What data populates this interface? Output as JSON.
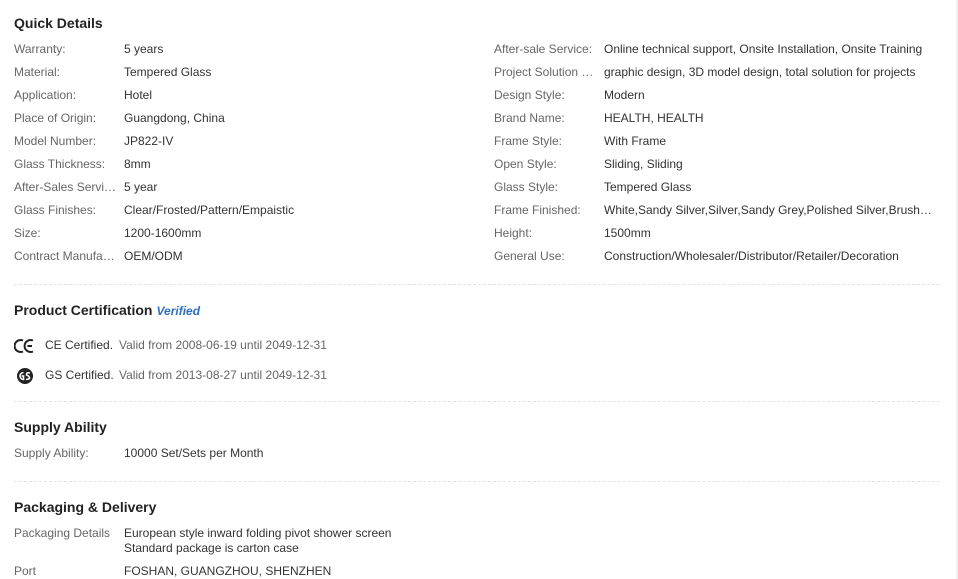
{
  "quick_details": {
    "title": "Quick Details",
    "left": [
      {
        "label": "Warranty:",
        "value": "5 years"
      },
      {
        "label": "Material:",
        "value": "Tempered Glass"
      },
      {
        "label": "Application:",
        "value": "Hotel"
      },
      {
        "label": "Place of Origin:",
        "value": "Guangdong, China"
      },
      {
        "label": "Model Number:",
        "value": "JP822-IV"
      },
      {
        "label": "Glass Thickness:",
        "value": "8mm"
      },
      {
        "label": "After-Sales Service:",
        "value": "5 year"
      },
      {
        "label": "Glass Finishes:",
        "value": "Clear/Frosted/Pattern/Empaistic"
      },
      {
        "label": "Size:",
        "value": "1200-1600mm"
      },
      {
        "label": "Contract Manufact...",
        "value": "OEM/ODM"
      }
    ],
    "right": [
      {
        "label": "After-sale Service:",
        "value": "Online technical support, Onsite Installation, Onsite Training"
      },
      {
        "label": "Project Solution Ca...",
        "value": "graphic design, 3D model design, total solution for projects"
      },
      {
        "label": "Design Style:",
        "value": "Modern"
      },
      {
        "label": "Brand Name:",
        "value": "HEALTH, HEALTH"
      },
      {
        "label": "Frame Style:",
        "value": "With Frame"
      },
      {
        "label": "Open Style:",
        "value": "Sliding, Sliding"
      },
      {
        "label": "Glass Style:",
        "value": "Tempered Glass"
      },
      {
        "label": "Frame Finished:",
        "value": "White,Sandy Silver,Silver,Sandy Grey,Polished Silver,Brushed Si..."
      },
      {
        "label": "Height:",
        "value": "1500mm"
      },
      {
        "label": "General Use:",
        "value": "Construction/Wholesaler/Distributor/Retailer/Decoration"
      }
    ]
  },
  "product_certification": {
    "title": "Product Certification",
    "verified": "Verified",
    "items": [
      {
        "icon": "ce-mark-icon",
        "name": "CE Certified.",
        "valid": "Valid from 2008-06-19 until 2049-12-31"
      },
      {
        "icon": "gs-mark-icon",
        "name": "GS Certified.",
        "valid": "Valid from 2013-08-27 until 2049-12-31"
      }
    ]
  },
  "supply_ability": {
    "title": "Supply Ability",
    "label": "Supply Ability:",
    "value": "10000 Set/Sets per Month"
  },
  "packaging_delivery": {
    "title": "Packaging & Delivery",
    "details_label": "Packaging Details",
    "details_line1": "European style inward folding pivot shower screen",
    "details_line2": "Standard package is carton case",
    "port_label": "Port",
    "port_value": "FOSHAN, GUANGZHOU, SHENZHEN"
  },
  "colors": {
    "verified": "#2f6fbf",
    "label": "#666666",
    "value": "#333333",
    "title": "#222222"
  }
}
